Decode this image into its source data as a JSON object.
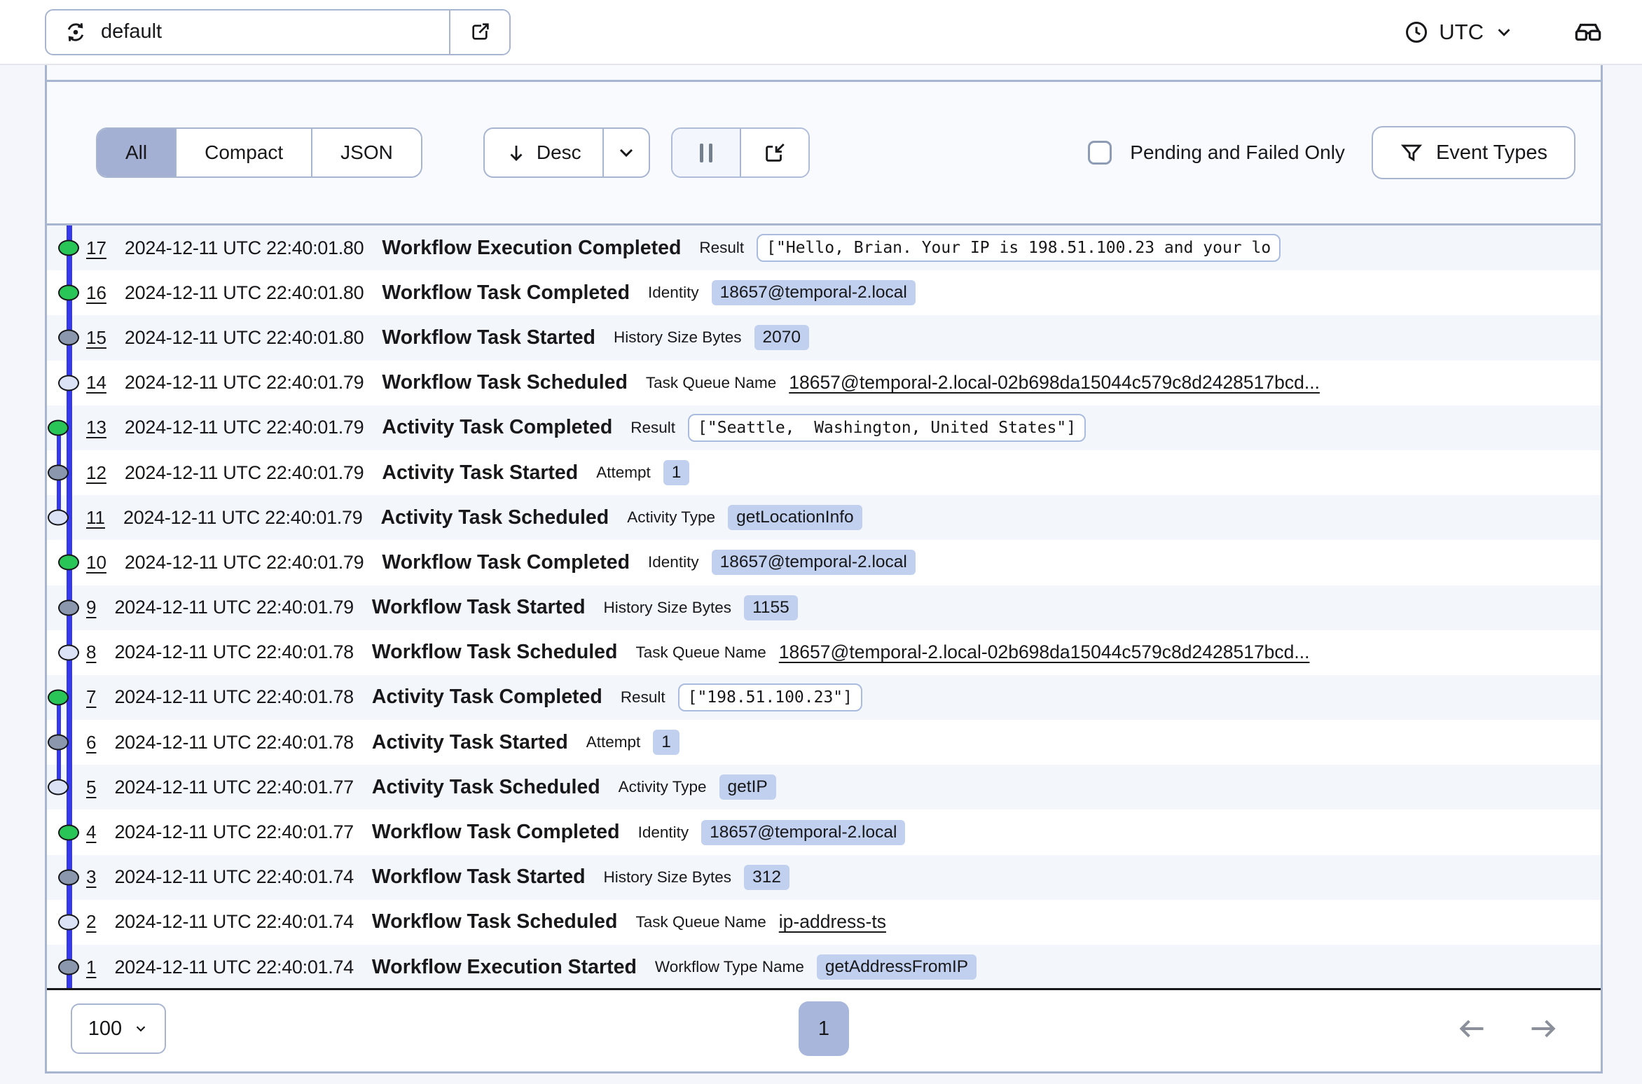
{
  "header": {
    "namespace_value": "default",
    "timezone_label": "UTC"
  },
  "toolbar": {
    "view_modes": [
      "All",
      "Compact",
      "JSON"
    ],
    "selected_view": "All",
    "sort_label": "Desc",
    "pending_failed_label": "Pending and Failed Only",
    "pending_failed_checked": false,
    "event_types_label": "Event Types"
  },
  "icons": [
    "namespace-switcher-icon",
    "external-link-icon",
    "clock-icon",
    "chevron-down-icon",
    "glasses-icon",
    "arrow-down-icon",
    "pause-icon",
    "download-icon",
    "filter-funnel-icon",
    "arrow-left-icon",
    "arrow-right-icon"
  ],
  "colors": {
    "accent_blue_line": "#3539EA",
    "dot_completed": "#29C657",
    "dot_started": "#8B97AC",
    "dot_scheduled": "#DBE2F6",
    "pill_bg": "#C0D0EE",
    "selected_segment": "#A3AFD3",
    "panel_border": "#A8B5D1",
    "page_button_bg": "#A8B6DB"
  },
  "events": [
    {
      "id": "17",
      "time": "2024-12-11 UTC 22:40:01.80",
      "name": "Workflow Execution Completed",
      "attr_label": "Result",
      "attr_value": "[\"Hello, Brian. Your IP is 198.51.100.23 and your lo",
      "value_kind": "code",
      "dot": "green",
      "branch": false
    },
    {
      "id": "16",
      "time": "2024-12-11 UTC 22:40:01.80",
      "name": "Workflow Task Completed",
      "attr_label": "Identity",
      "attr_value": "18657@temporal-2.local",
      "value_kind": "pill",
      "dot": "green",
      "branch": false
    },
    {
      "id": "15",
      "time": "2024-12-11 UTC 22:40:01.80",
      "name": "Workflow Task Started",
      "attr_label": "History Size Bytes",
      "attr_value": "2070",
      "value_kind": "pill",
      "dot": "gray",
      "branch": false
    },
    {
      "id": "14",
      "time": "2024-12-11 UTC 22:40:01.79",
      "name": "Workflow Task Scheduled",
      "attr_label": "Task Queue Name",
      "attr_value": "18657@temporal-2.local-02b698da15044c579c8d2428517bcd...",
      "value_kind": "link",
      "dot": "light",
      "branch": false
    },
    {
      "id": "13",
      "time": "2024-12-11 UTC 22:40:01.79",
      "name": "Activity Task Completed",
      "attr_label": "Result",
      "attr_value": "[\"Seattle,  Washington, United States\"]",
      "value_kind": "code",
      "dot": "green",
      "branch": true
    },
    {
      "id": "12",
      "time": "2024-12-11 UTC 22:40:01.79",
      "name": "Activity Task Started",
      "attr_label": "Attempt",
      "attr_value": "1",
      "value_kind": "pill",
      "dot": "gray",
      "branch": true
    },
    {
      "id": "11",
      "time": "2024-12-11 UTC 22:40:01.79",
      "name": "Activity Task Scheduled",
      "attr_label": "Activity Type",
      "attr_value": "getLocationInfo",
      "value_kind": "pill",
      "dot": "light",
      "branch": true
    },
    {
      "id": "10",
      "time": "2024-12-11 UTC 22:40:01.79",
      "name": "Workflow Task Completed",
      "attr_label": "Identity",
      "attr_value": "18657@temporal-2.local",
      "value_kind": "pill",
      "dot": "green",
      "branch": false
    },
    {
      "id": "9",
      "time": "2024-12-11 UTC 22:40:01.79",
      "name": "Workflow Task Started",
      "attr_label": "History Size Bytes",
      "attr_value": "1155",
      "value_kind": "pill",
      "dot": "gray",
      "branch": false
    },
    {
      "id": "8",
      "time": "2024-12-11 UTC 22:40:01.78",
      "name": "Workflow Task Scheduled",
      "attr_label": "Task Queue Name",
      "attr_value": "18657@temporal-2.local-02b698da15044c579c8d2428517bcd...",
      "value_kind": "link",
      "dot": "light",
      "branch": false
    },
    {
      "id": "7",
      "time": "2024-12-11 UTC 22:40:01.78",
      "name": "Activity Task Completed",
      "attr_label": "Result",
      "attr_value": "[\"198.51.100.23\"]",
      "value_kind": "code",
      "dot": "green",
      "branch": true
    },
    {
      "id": "6",
      "time": "2024-12-11 UTC 22:40:01.78",
      "name": "Activity Task Started",
      "attr_label": "Attempt",
      "attr_value": "1",
      "value_kind": "pill",
      "dot": "gray",
      "branch": true
    },
    {
      "id": "5",
      "time": "2024-12-11 UTC 22:40:01.77",
      "name": "Activity Task Scheduled",
      "attr_label": "Activity Type",
      "attr_value": "getIP",
      "value_kind": "pill",
      "dot": "light",
      "branch": true
    },
    {
      "id": "4",
      "time": "2024-12-11 UTC 22:40:01.77",
      "name": "Workflow Task Completed",
      "attr_label": "Identity",
      "attr_value": "18657@temporal-2.local",
      "value_kind": "pill",
      "dot": "green",
      "branch": false
    },
    {
      "id": "3",
      "time": "2024-12-11 UTC 22:40:01.74",
      "name": "Workflow Task Started",
      "attr_label": "History Size Bytes",
      "attr_value": "312",
      "value_kind": "pill",
      "dot": "gray",
      "branch": false
    },
    {
      "id": "2",
      "time": "2024-12-11 UTC 22:40:01.74",
      "name": "Workflow Task Scheduled",
      "attr_label": "Task Queue Name",
      "attr_value": "ip-address-ts",
      "value_kind": "link",
      "dot": "light",
      "branch": false
    },
    {
      "id": "1",
      "time": "2024-12-11 UTC 22:40:01.74",
      "name": "Workflow Execution Started",
      "attr_label": "Workflow Type Name",
      "attr_value": "getAddressFromIP",
      "value_kind": "pill",
      "dot": "gray",
      "branch": false
    }
  ],
  "footer": {
    "rows_per_page": "100",
    "current_page": "1"
  }
}
